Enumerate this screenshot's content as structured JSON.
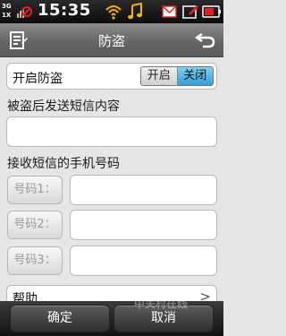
{
  "status_bar": {
    "network_top": "3G",
    "network_bottom": "1X",
    "time": "15:35"
  },
  "title_bar": {
    "title": "防盗"
  },
  "theft_toggle": {
    "label": "开启防盗",
    "on_label": "开启",
    "off_label": "关闭",
    "selected": "关闭"
  },
  "sms_content": {
    "label": "被盗后发送短信内容",
    "value": ""
  },
  "receivers": {
    "label": "接收短信的手机号码",
    "numbers": [
      {
        "button": "号码1：",
        "value": ""
      },
      {
        "button": "号码2：",
        "value": ""
      },
      {
        "button": "号码3：",
        "value": ""
      }
    ]
  },
  "help": {
    "label": "帮助",
    "chevron": ">"
  },
  "bottom_bar": {
    "confirm_label": "确定",
    "cancel_label": "取消"
  },
  "watermark": "中关村在线",
  "colors": {
    "toggle_selected": "#2fa0da",
    "title_bar": "#6e6e6e",
    "bottom_bar": "#1f1f1f",
    "background": "#e6e6e6"
  }
}
